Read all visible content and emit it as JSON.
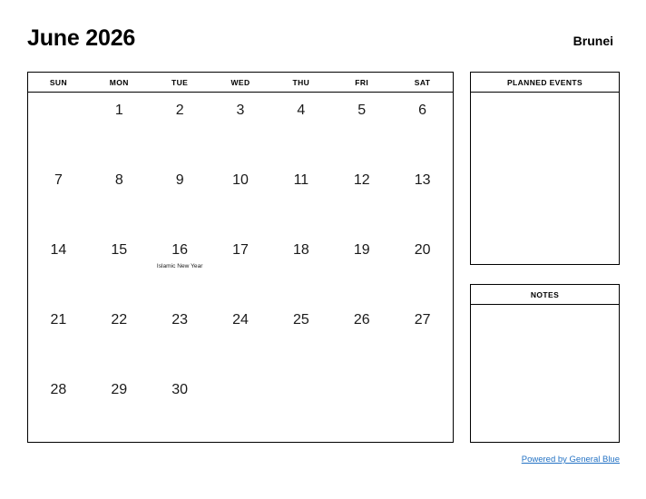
{
  "header": {
    "title": "June 2026",
    "locale": "Brunei"
  },
  "calendar": {
    "day_headers": [
      "SUN",
      "MON",
      "TUE",
      "WED",
      "THU",
      "FRI",
      "SAT"
    ],
    "weeks": [
      [
        {
          "day": "",
          "event": ""
        },
        {
          "day": "1",
          "event": ""
        },
        {
          "day": "2",
          "event": ""
        },
        {
          "day": "3",
          "event": ""
        },
        {
          "day": "4",
          "event": ""
        },
        {
          "day": "5",
          "event": ""
        },
        {
          "day": "6",
          "event": ""
        }
      ],
      [
        {
          "day": "7",
          "event": ""
        },
        {
          "day": "8",
          "event": ""
        },
        {
          "day": "9",
          "event": ""
        },
        {
          "day": "10",
          "event": ""
        },
        {
          "day": "11",
          "event": ""
        },
        {
          "day": "12",
          "event": ""
        },
        {
          "day": "13",
          "event": ""
        }
      ],
      [
        {
          "day": "14",
          "event": ""
        },
        {
          "day": "15",
          "event": ""
        },
        {
          "day": "16",
          "event": "Islamic New Year"
        },
        {
          "day": "17",
          "event": ""
        },
        {
          "day": "18",
          "event": ""
        },
        {
          "day": "19",
          "event": ""
        },
        {
          "day": "20",
          "event": ""
        }
      ],
      [
        {
          "day": "21",
          "event": ""
        },
        {
          "day": "22",
          "event": ""
        },
        {
          "day": "23",
          "event": ""
        },
        {
          "day": "24",
          "event": ""
        },
        {
          "day": "25",
          "event": ""
        },
        {
          "day": "26",
          "event": ""
        },
        {
          "day": "27",
          "event": ""
        }
      ],
      [
        {
          "day": "28",
          "event": ""
        },
        {
          "day": "29",
          "event": ""
        },
        {
          "day": "30",
          "event": ""
        },
        {
          "day": "",
          "event": ""
        },
        {
          "day": "",
          "event": ""
        },
        {
          "day": "",
          "event": ""
        },
        {
          "day": "",
          "event": ""
        }
      ]
    ]
  },
  "panels": {
    "planned_events": {
      "title": "PLANNED EVENTS",
      "content": ""
    },
    "notes": {
      "title": "NOTES",
      "content": ""
    }
  },
  "footer": {
    "link_label": "Powered by General Blue",
    "link_color": "#2372c4"
  }
}
